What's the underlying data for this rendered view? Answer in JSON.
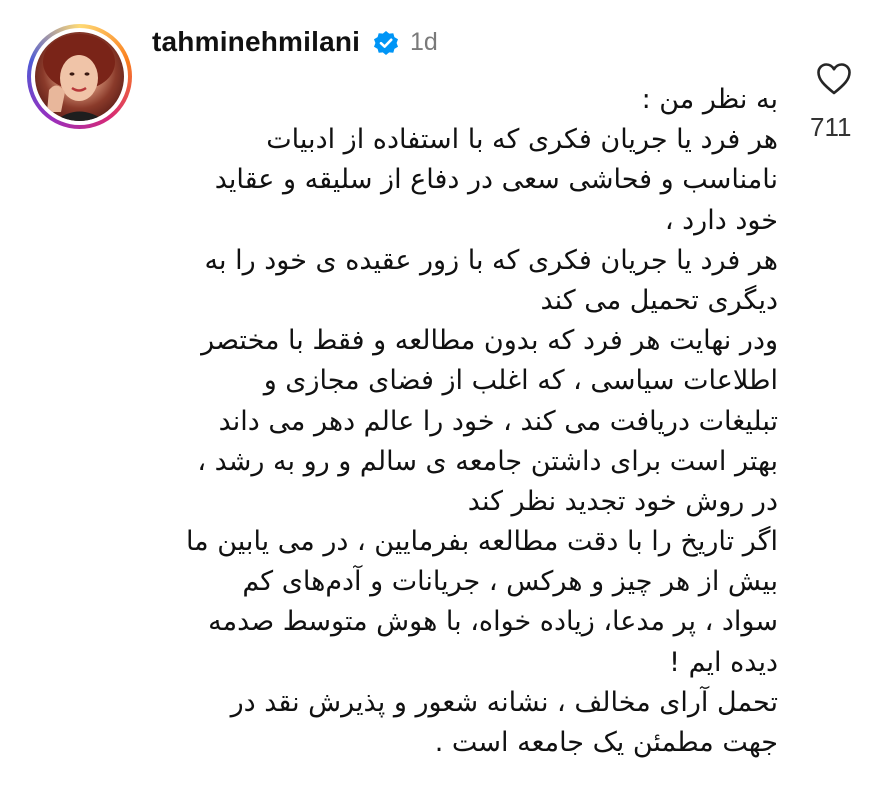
{
  "post": {
    "username": "tahminehmilani",
    "verified_icon": "verified-badge-icon",
    "time_ago": "1d",
    "like_icon": "heart-outline-icon",
    "like_count": "711",
    "caption_lines": [
      "به نظر من :",
      "هر فرد یا جریان فکری  که با استفاده از ادبیات",
      "نامناسب و فحاشی سعی در دفاع از سلیقه و عقاید",
      "خود دارد ،",
      "هر فرد یا جریان فکری که با زور عقیده ی خود را به",
      "دیگری تحمیل می کند",
      "ودر نهایت هر فرد که بدون مطالعه و فقط با مختصر",
      "اطلاعات سیاسی ، که اغلب از فضای مجازی و",
      "تبلیغات دریافت می کند ، خود  را عالم دهر می داند",
      "بهتر است برای داشتن جامعه ی سالم و رو به رشد ،",
      "در روش خود تجدید نظر کند",
      "اگر تاریخ را با دقت مطالعه بفرمایین ، در می یابین ما",
      "بیش از هر چیز و هرکس ، جریانات و  آدم‌های کم",
      "سواد ،  پر مدعا، زیاده خواه، با هوش متوسط  صدمه",
      "دیده ایم !",
      "تحمل آرای مخالف ، نشانه شعور و پذیرش نقد در",
      "جهت مطمئن یک جامعه است ."
    ]
  },
  "colors": {
    "verified_blue": "#0095f6",
    "muted_text": "#7a7a7a",
    "text": "#111111"
  }
}
